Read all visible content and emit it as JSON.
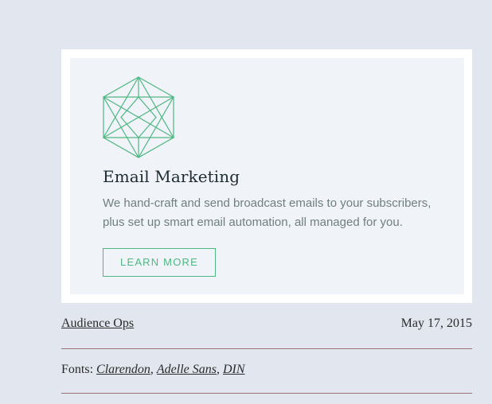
{
  "card": {
    "icon": "geometric-hexagon-logo",
    "title": "Email Marketing",
    "description": "We hand-craft and send broadcast emails to your subscribers, plus set up smart email automation, all managed for you.",
    "button_label": "LEARN MORE",
    "accent_color": "#4fb783"
  },
  "meta": {
    "author": "Audience Ops",
    "date": "May 17, 2015",
    "fonts_label": "Fonts:",
    "fonts": [
      "Clarendon",
      "Adelle Sans",
      "DIN"
    ],
    "separator": ","
  }
}
